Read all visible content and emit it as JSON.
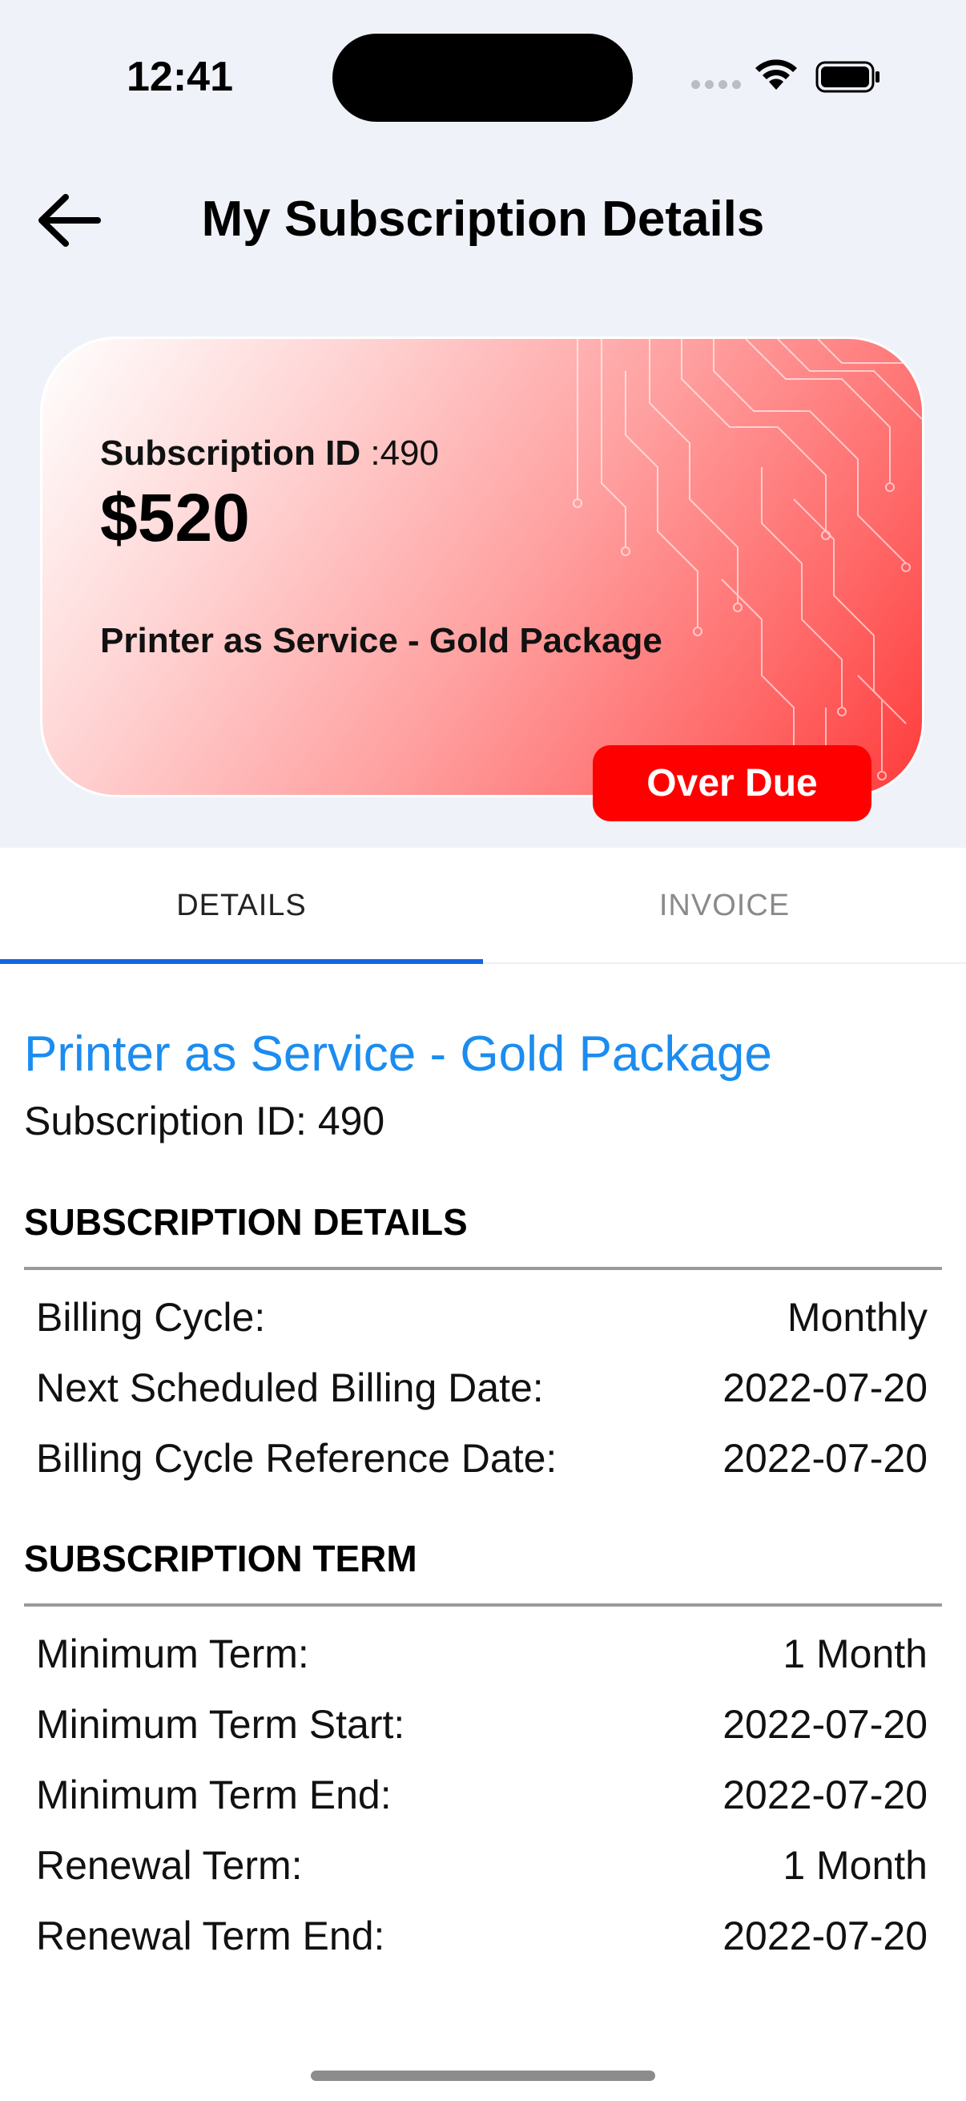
{
  "status_bar": {
    "time": "12:41"
  },
  "header": {
    "title": "My Subscription Details"
  },
  "card": {
    "sub_id_label": "Subscription ID",
    "sub_id_value": ":490",
    "price": "$520",
    "package_name": "Printer as Service - Gold Package",
    "badge": "Over Due"
  },
  "tabs": [
    {
      "label": "DETAILS"
    },
    {
      "label": "INVOICE"
    }
  ],
  "details": {
    "title": "Printer as Service - Gold Package",
    "subscription_id": "Subscription ID: 490",
    "sections": [
      {
        "heading": "SUBSCRIPTION DETAILS",
        "rows": [
          {
            "label": "Billing Cycle:",
            "value": "Monthly"
          },
          {
            "label": "Next Scheduled Billing Date:",
            "value": "2022-07-20"
          },
          {
            "label": "Billing Cycle Reference Date:",
            "value": "2022-07-20"
          }
        ]
      },
      {
        "heading": "SUBSCRIPTION TERM",
        "rows": [
          {
            "label": "Minimum Term:",
            "value": "1 Month"
          },
          {
            "label": "Minimum Term Start:",
            "value": "2022-07-20"
          },
          {
            "label": "Minimum Term End:",
            "value": "2022-07-20"
          },
          {
            "label": "Renewal Term:",
            "value": "1 Month"
          },
          {
            "label": "Renewal Term End:",
            "value": "2022-07-20"
          }
        ]
      }
    ]
  },
  "colors": {
    "accent_blue": "#1b8cf0",
    "tab_indicator": "#1565e0",
    "badge_red": "#ff0000",
    "background": "#eff2f8"
  },
  "icons": {
    "back": "arrow-left-icon",
    "wifi": "wifi-icon",
    "battery": "battery-icon",
    "signal": "signal-dots-icon"
  }
}
